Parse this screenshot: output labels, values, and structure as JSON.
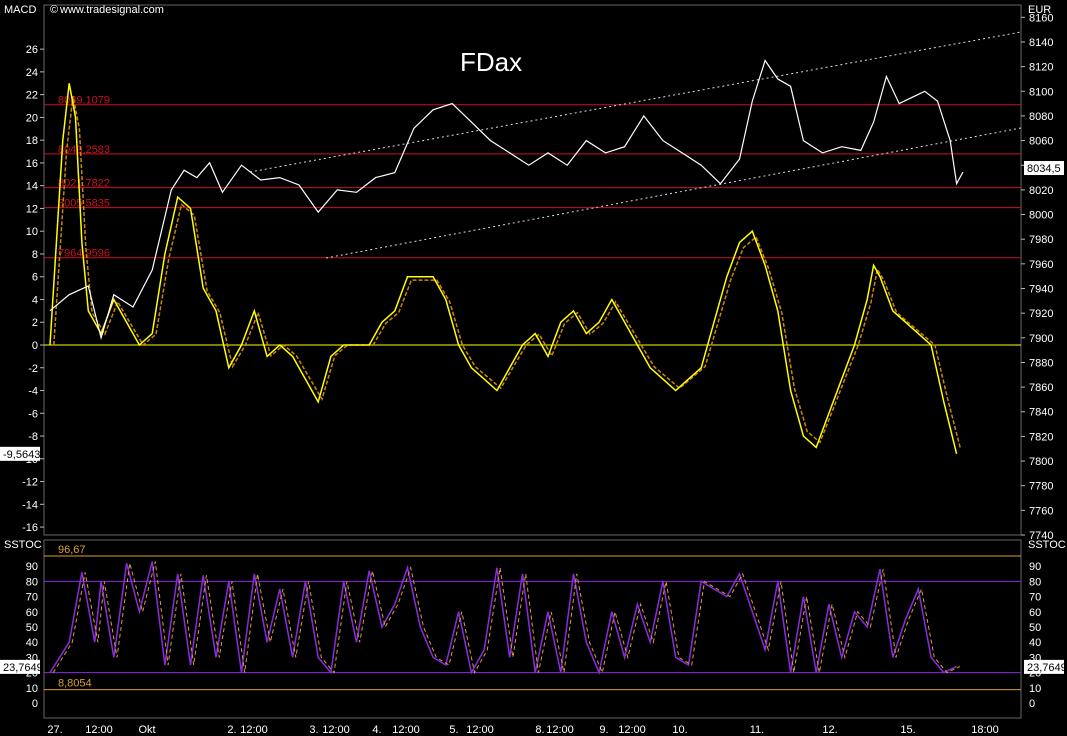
{
  "header": {
    "left_label": "MACD",
    "source": "www.tradesignal.com",
    "right_unit": "EUR"
  },
  "chart_data": [
    {
      "type": "line",
      "title": "FDax",
      "price_axis": {
        "unit": "EUR",
        "ylim": [
          7740,
          8170
        ],
        "ticks": [
          "8160",
          "8140",
          "8120",
          "8100",
          "8080",
          "8060",
          "8040",
          "8020",
          "8000",
          "7980",
          "7960",
          "7940",
          "7920",
          "7900",
          "7880",
          "7860",
          "7840",
          "7820",
          "7800",
          "7780",
          "7760",
          "7740"
        ]
      },
      "macd_axis": {
        "ylim": [
          -17,
          28
        ],
        "ticks": [
          "26",
          "24",
          "22",
          "20",
          "18",
          "16",
          "14",
          "12",
          "10",
          "8",
          "6",
          "4",
          "2",
          "0",
          "-2",
          "-4",
          "-6",
          "-8",
          "-10",
          "-12",
          "-14",
          "-16"
        ]
      },
      "x_labels": [
        "27.",
        "12:00",
        "Okt",
        "2.",
        "12:00",
        "3.",
        "12:00",
        "4.",
        "12:00",
        "5.",
        "12:00",
        "8.",
        "12:00",
        "9.",
        "12:00",
        "10.",
        "11.",
        "12.",
        "15.",
        "18:00"
      ],
      "levels": [
        {
          "label": "8089,1079",
          "value": 8089.1079
        },
        {
          "label": "8049,2583",
          "value": 8049.2583
        },
        {
          "label": "8021,7822",
          "value": 8021.7822
        },
        {
          "label": "8005,5835",
          "value": 8005.5835
        },
        {
          "label": "7964,9596",
          "value": 7964.9596
        }
      ],
      "last_price_label": "8034,5",
      "last_macd_label": "-9,5643",
      "price_series": {
        "name": "",
        "points": [
          [
            0,
            7922
          ],
          [
            3,
            7935
          ],
          [
            6,
            7942
          ],
          [
            8,
            7900
          ],
          [
            10,
            7935
          ],
          [
            13,
            7925
          ],
          [
            16,
            7955
          ],
          [
            19,
            8020
          ],
          [
            21,
            8036
          ],
          [
            23,
            8030
          ],
          [
            25,
            8042
          ],
          [
            27,
            8018
          ],
          [
            30,
            8040
          ],
          [
            33,
            8028
          ],
          [
            36,
            8030
          ],
          [
            39,
            8024
          ],
          [
            42,
            8002
          ],
          [
            45,
            8020
          ],
          [
            48,
            8018
          ],
          [
            51,
            8030
          ],
          [
            54,
            8034
          ],
          [
            57,
            8070
          ],
          [
            60,
            8085
          ],
          [
            63,
            8090
          ],
          [
            66,
            8075
          ],
          [
            69,
            8060
          ],
          [
            72,
            8050
          ],
          [
            75,
            8040
          ],
          [
            78,
            8050
          ],
          [
            81,
            8040
          ],
          [
            84,
            8060
          ],
          [
            87,
            8050
          ],
          [
            90,
            8055
          ],
          [
            93,
            8080
          ],
          [
            96,
            8060
          ],
          [
            99,
            8050
          ],
          [
            102,
            8040
          ],
          [
            105,
            8025
          ],
          [
            108,
            8045
          ],
          [
            110,
            8092
          ],
          [
            112,
            8125
          ],
          [
            114,
            8110
          ],
          [
            116,
            8104
          ],
          [
            118,
            8060
          ],
          [
            121,
            8050
          ],
          [
            124,
            8055
          ],
          [
            127,
            8052
          ],
          [
            129,
            8075
          ],
          [
            131,
            8112
          ],
          [
            133,
            8090
          ],
          [
            135,
            8095
          ],
          [
            137,
            8100
          ],
          [
            139,
            8092
          ],
          [
            141,
            8060
          ],
          [
            142,
            8025
          ],
          [
            143,
            8034.5
          ]
        ]
      },
      "macd_series": {
        "name": "",
        "points": [
          [
            0,
            0
          ],
          [
            2,
            18
          ],
          [
            3,
            23
          ],
          [
            4,
            20
          ],
          [
            5,
            9
          ],
          [
            6,
            3
          ],
          [
            8,
            1
          ],
          [
            10,
            4
          ],
          [
            12,
            2
          ],
          [
            14,
            0
          ],
          [
            16,
            1
          ],
          [
            18,
            8
          ],
          [
            20,
            13
          ],
          [
            22,
            12
          ],
          [
            24,
            5
          ],
          [
            26,
            3
          ],
          [
            28,
            -2
          ],
          [
            30,
            0
          ],
          [
            32,
            3
          ],
          [
            34,
            -1
          ],
          [
            36,
            0
          ],
          [
            38,
            -1
          ],
          [
            40,
            -3
          ],
          [
            42,
            -5
          ],
          [
            44,
            -1
          ],
          [
            46,
            0
          ],
          [
            48,
            0
          ],
          [
            50,
            0
          ],
          [
            52,
            2
          ],
          [
            54,
            3
          ],
          [
            56,
            6
          ],
          [
            58,
            6
          ],
          [
            60,
            6
          ],
          [
            62,
            4
          ],
          [
            64,
            0
          ],
          [
            66,
            -2
          ],
          [
            68,
            -3
          ],
          [
            70,
            -4
          ],
          [
            72,
            -2
          ],
          [
            74,
            0
          ],
          [
            76,
            1
          ],
          [
            78,
            -1
          ],
          [
            80,
            2
          ],
          [
            82,
            3
          ],
          [
            84,
            1
          ],
          [
            86,
            2
          ],
          [
            88,
            4
          ],
          [
            90,
            2
          ],
          [
            92,
            0
          ],
          [
            94,
            -2
          ],
          [
            96,
            -3
          ],
          [
            98,
            -4
          ],
          [
            100,
            -3
          ],
          [
            102,
            -2
          ],
          [
            104,
            2
          ],
          [
            106,
            6
          ],
          [
            108,
            9
          ],
          [
            110,
            10
          ],
          [
            112,
            7
          ],
          [
            114,
            3
          ],
          [
            116,
            -4
          ],
          [
            118,
            -8
          ],
          [
            120,
            -9
          ],
          [
            122,
            -6
          ],
          [
            124,
            -3
          ],
          [
            126,
            0
          ],
          [
            128,
            4
          ],
          [
            129,
            7
          ],
          [
            130,
            6
          ],
          [
            132,
            3
          ],
          [
            134,
            2
          ],
          [
            136,
            1
          ],
          [
            138,
            0
          ],
          [
            140,
            -5
          ],
          [
            142,
            -9.5643
          ]
        ]
      }
    },
    {
      "type": "line",
      "title": "",
      "left_label": "SSTOC",
      "right_label": "SSTOC",
      "ylim": [
        -5,
        100
      ],
      "ticks": [
        "90",
        "80",
        "70",
        "60",
        "50",
        "40",
        "30",
        "20",
        "10",
        "0"
      ],
      "levels": [
        {
          "label": "96,67",
          "value": 96.67,
          "color": "#d9a030"
        },
        {
          "label": "",
          "value": 80,
          "color": "#8a2be2"
        },
        {
          "label": "",
          "value": 20,
          "color": "#8a2be2"
        },
        {
          "label": "8,8054",
          "value": 8.8054,
          "color": "#d9a030"
        }
      ],
      "last_value_label": "23,7649",
      "series": {
        "name": "",
        "points": [
          [
            0,
            20
          ],
          [
            3,
            40
          ],
          [
            5,
            86
          ],
          [
            7,
            40
          ],
          [
            8,
            80
          ],
          [
            10,
            30
          ],
          [
            12,
            92
          ],
          [
            14,
            60
          ],
          [
            16,
            93
          ],
          [
            18,
            25
          ],
          [
            20,
            85
          ],
          [
            22,
            25
          ],
          [
            24,
            84
          ],
          [
            26,
            30
          ],
          [
            28,
            80
          ],
          [
            30,
            20
          ],
          [
            32,
            85
          ],
          [
            34,
            40
          ],
          [
            36,
            75
          ],
          [
            38,
            30
          ],
          [
            40,
            80
          ],
          [
            42,
            30
          ],
          [
            44,
            20
          ],
          [
            46,
            80
          ],
          [
            48,
            40
          ],
          [
            50,
            87
          ],
          [
            52,
            50
          ],
          [
            54,
            65
          ],
          [
            56,
            89
          ],
          [
            58,
            50
          ],
          [
            60,
            30
          ],
          [
            62,
            25
          ],
          [
            64,
            60
          ],
          [
            66,
            20
          ],
          [
            68,
            35
          ],
          [
            70,
            89
          ],
          [
            72,
            30
          ],
          [
            74,
            85
          ],
          [
            76,
            20
          ],
          [
            78,
            60
          ],
          [
            80,
            20
          ],
          [
            82,
            85
          ],
          [
            84,
            40
          ],
          [
            86,
            20
          ],
          [
            88,
            60
          ],
          [
            90,
            30
          ],
          [
            92,
            65
          ],
          [
            94,
            40
          ],
          [
            96,
            80
          ],
          [
            98,
            30
          ],
          [
            100,
            25
          ],
          [
            102,
            80
          ],
          [
            104,
            75
          ],
          [
            106,
            70
          ],
          [
            108,
            85
          ],
          [
            110,
            60
          ],
          [
            112,
            35
          ],
          [
            114,
            80
          ],
          [
            116,
            20
          ],
          [
            118,
            70
          ],
          [
            120,
            20
          ],
          [
            122,
            65
          ],
          [
            124,
            30
          ],
          [
            126,
            60
          ],
          [
            128,
            50
          ],
          [
            130,
            88
          ],
          [
            132,
            30
          ],
          [
            134,
            55
          ],
          [
            136,
            75
          ],
          [
            138,
            30
          ],
          [
            140,
            20
          ],
          [
            142,
            24
          ]
        ]
      }
    }
  ],
  "colors": {
    "background": "#000000",
    "price": "#ffffff",
    "macd": "#ffff00",
    "macd_signal": "#cc8800",
    "level": "#cc1122",
    "zero": "#ffff00",
    "stoch": "#8a2be2",
    "stoch_signal": "#d9a030"
  }
}
